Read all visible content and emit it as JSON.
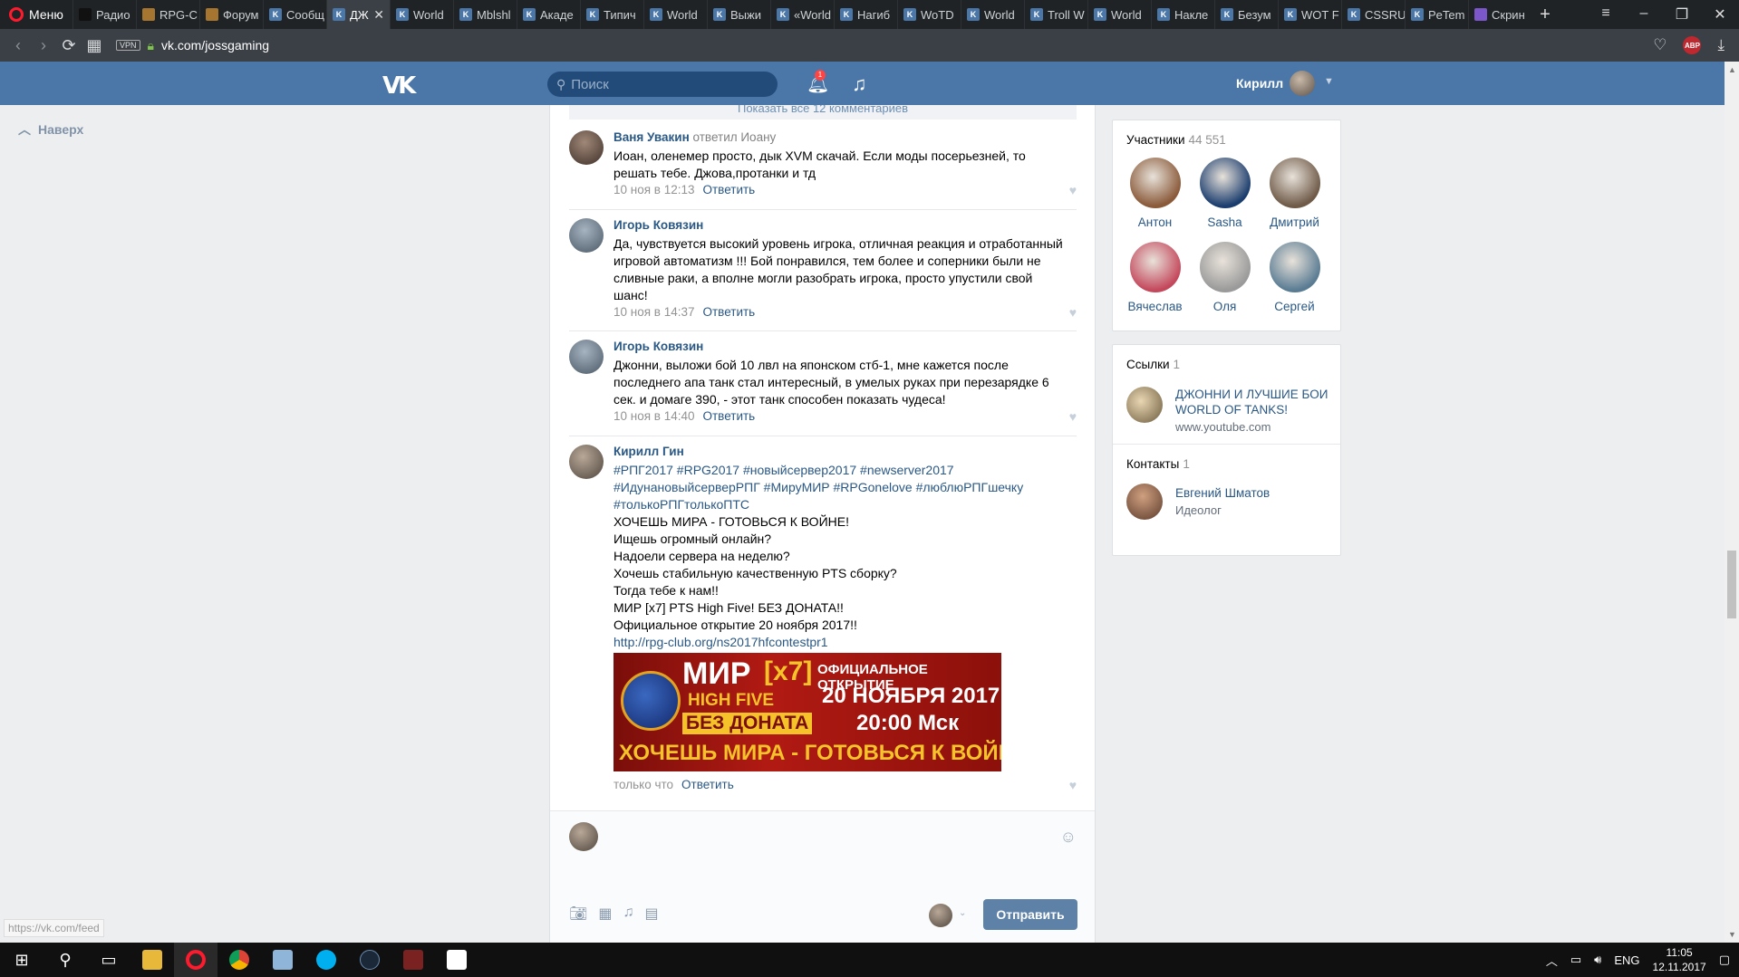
{
  "browser": {
    "menu_label": "Меню",
    "tabs": [
      {
        "label": "Радио",
        "fav": "dark"
      },
      {
        "label": "RPG-C",
        "fav": "gold"
      },
      {
        "label": "Форум",
        "fav": "gold"
      },
      {
        "label": "Сообщ",
        "fav": "vk"
      },
      {
        "label": "ДЖ",
        "fav": "vk",
        "active": true
      },
      {
        "label": "World",
        "fav": "vk"
      },
      {
        "label": "Mblshl",
        "fav": "vk"
      },
      {
        "label": "Акаде",
        "fav": "vk"
      },
      {
        "label": "Типич",
        "fav": "vk"
      },
      {
        "label": "World",
        "fav": "vk"
      },
      {
        "label": "Выжи",
        "fav": "vk"
      },
      {
        "label": "«World",
        "fav": "vk"
      },
      {
        "label": "Нагиб",
        "fav": "vk"
      },
      {
        "label": "WoTD",
        "fav": "vk"
      },
      {
        "label": "World",
        "fav": "vk"
      },
      {
        "label": "Troll W",
        "fav": "vk"
      },
      {
        "label": "World",
        "fav": "vk"
      },
      {
        "label": "Накле",
        "fav": "vk"
      },
      {
        "label": "Безум",
        "fav": "vk"
      },
      {
        "label": "WOT F",
        "fav": "vk"
      },
      {
        "label": "CSSRU",
        "fav": "vk"
      },
      {
        "label": "PeTem",
        "fav": "vk"
      },
      {
        "label": "Скрин",
        "fav": "purple"
      }
    ],
    "url": "vk.com/jossgaming",
    "vpn_label": "VPN",
    "adblock_label": "ABP",
    "status_url": "https://vk.com/feed"
  },
  "vk_header": {
    "logo": "VK",
    "search_placeholder": "Поиск",
    "notifications_count": "1",
    "user_name": "Кирилл"
  },
  "left": {
    "up_label": "Наверх"
  },
  "wall": {
    "show_all": "Показать все 12 комментариев",
    "comments": [
      {
        "author": "Ваня Увакин",
        "reply_to": "ответил Иоану",
        "text": "Иоан, оленемер просто, дык XVM скачай. Если моды посерьезней, то решать тебе. Джова,протанки и тд",
        "time": "10 ноя в 12:13",
        "reply": "Ответить"
      },
      {
        "author": "Игорь Ковязин",
        "reply_to": "",
        "text": "Да, чувствуется высокий уровень игрока, отличная реакция и отработанный игровой автоматизм !!! Бой понравился, тем более и соперники были не сливные раки, а вполне могли разобрать игрока, просто упустили свой шанс!",
        "time": "10 ноя в 14:37",
        "reply": "Ответить"
      },
      {
        "author": "Игорь Ковязин",
        "reply_to": "",
        "text": "Джонни, выложи бой 10 лвл на японском стб-1, мне кажется после последнего апа танк стал интересный, в умелых руках при перезарядке 6 сек. и домаге 390, - этот танк способен показать чудеса!",
        "time": "10 ноя в 14:40",
        "reply": "Ответить"
      },
      {
        "author": "Кирилл Гин",
        "reply_to": "",
        "hashtags": "#РПГ2017 #RPG2017 #новыйсервер2017 #newserver2017 #ИдунановыйсерверРПГ #МируМИР #RPGonelove #люблюРПГшечку #толькоРПГтолькоПТС",
        "lines": [
          "ХОЧЕШЬ МИРА - ГОТОВЬСЯ К ВОЙНЕ!",
          "Ищешь огромный онлайн?",
          "Надоели сервера на неделю?",
          "Хочешь стабильную качественную PTS сборку?",
          "Тогда тебе к нам!!",
          "МИР [x7] PTS High Five! БЕЗ ДОНАТА!!",
          "Официальное открытие 20 ноября 2017!!"
        ],
        "link": "http://rpg-club.org/ns2017hfcontestpr1",
        "banner": {
          "mir": "МИР",
          "x7": "[x7]",
          "high_five": "HIGH FIVE",
          "no_donate": "БЕЗ ДОНАТА",
          "opening": "ОФИЦИАЛЬНОЕ ОТКРЫТИЕ",
          "date": "20 НОЯБРЯ 2017",
          "time": "20:00 Мск",
          "slogan": "ХОЧЕШЬ МИРА - ГОТОВЬСЯ К ВОЙНЕ"
        },
        "time": "только что",
        "reply": "Ответить"
      }
    ],
    "send_label": "Отправить"
  },
  "sidebar": {
    "members_title": "Участники",
    "members_count": "44 551",
    "members": [
      {
        "name": "Антон",
        "color": "#8a5a3a"
      },
      {
        "name": "Sasha",
        "color": "#1b3d6e"
      },
      {
        "name": "Дмитрий",
        "color": "#6f5a48"
      },
      {
        "name": "Вячеслав",
        "color": "#c4485c"
      },
      {
        "name": "Оля",
        "color": "#9a9a9a"
      },
      {
        "name": "Сергей",
        "color": "#5a7c93"
      }
    ],
    "links_title": "Ссылки",
    "links_count": "1",
    "link_title": "ДЖОННИ И ЛУЧШИЕ БОИ WORLD OF TANKS!",
    "link_domain": "www.youtube.com",
    "contacts_title": "Контакты",
    "contacts_count": "1",
    "contact_name": "Евгений Шматов",
    "contact_role": "Идеолог"
  },
  "taskbar": {
    "lang": "ENG",
    "time": "11:05",
    "date": "12.11.2017"
  }
}
